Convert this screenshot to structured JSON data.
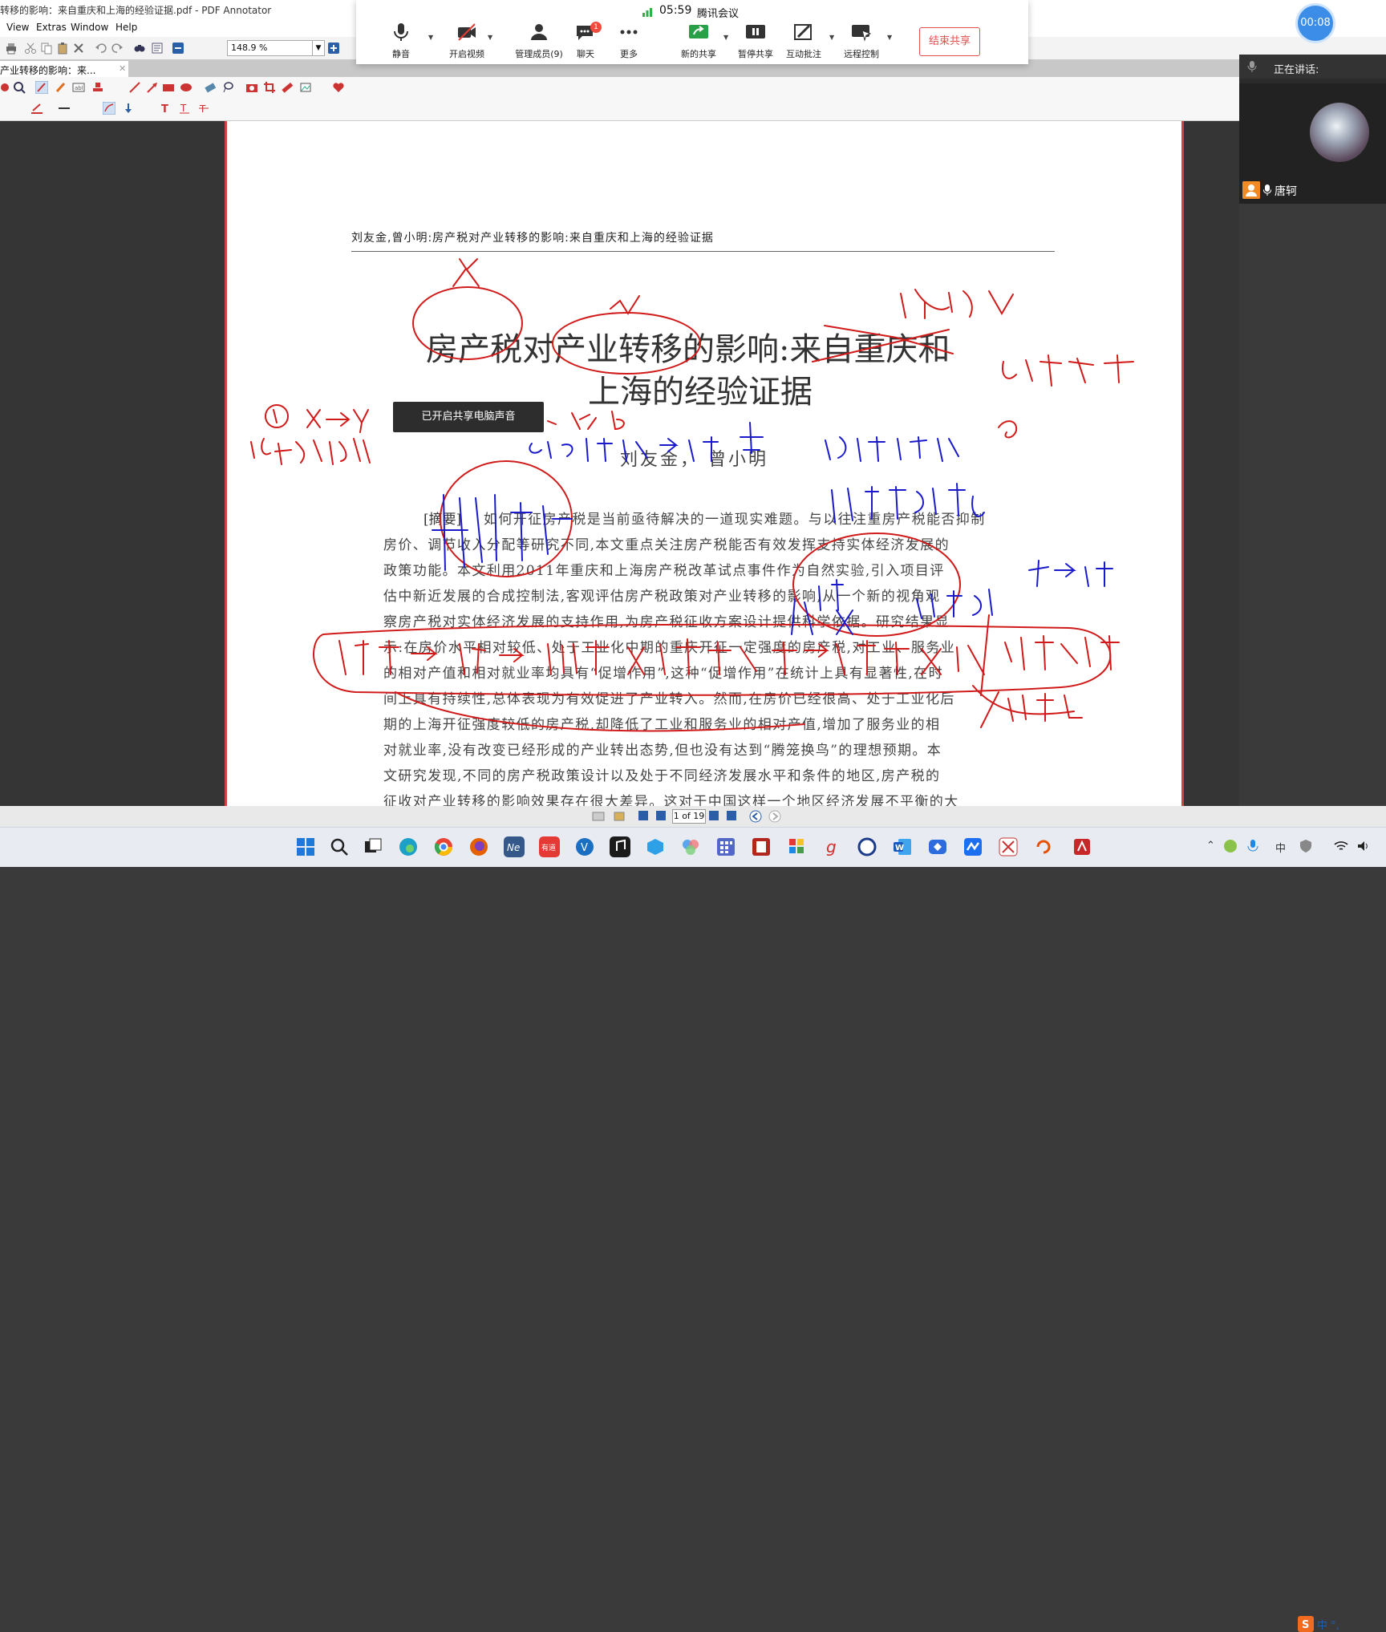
{
  "window": {
    "title": "转移的影响：来自重庆和上海的经验证据.pdf - PDF Annotator"
  },
  "menu": {
    "items": [
      "View",
      "Extras",
      "Window",
      "Help"
    ]
  },
  "toolbar": {
    "zoom_value": "148.9 %"
  },
  "tab": {
    "label": "产业转移的影响：来...",
    "close": "✕"
  },
  "document": {
    "running_head": "刘友金,曾小明:房产税对产业转移的影响:来自重庆和上海的经验证据",
    "title_line1": "房产税对产业转移的影响:来自重庆和",
    "title_line2": "上海的经验证据",
    "authors": "刘友金，  曾小明",
    "abstract_label": "[摘要]",
    "abstract_lines": [
      "如何开征房产税是当前亟待解决的一道现实难题。与以往注重房产税能否抑制",
      "房价、调节收入分配等研究不同,本文重点关注房产税能否有效发挥支持实体经济发展的",
      "政策功能。本文利用2011年重庆和上海房产税改革试点事件作为自然实验,引入项目评",
      "估中新近发展的合成控制法,客观评估房产税政策对产业转移的影响,从一个新的视角观",
      "察房产税对实体经济发展的支持作用,为房产税征收方案设计提供科学依据。研究结果显",
      "示:在房价水平相对较低、处于工业化中期的重庆开征一定强度的房产税,对工业、服务业",
      "的相对产值和相对就业率均具有“促增作用”,这种“促增作用”在统计上具有显著性,在时",
      "间上具有持续性,总体表现为有效促进了产业转入。然而,在房价已经很高、处于工业化后",
      "期的上海开征强度较低的房产税,却降低了工业和服务业的相对产值,增加了服务业的相",
      "对就业率,没有改变已经形成的产业转出态势,但也没有达到“腾笼换鸟”的理想预期。本",
      "文研究发现,不同的房产税政策设计以及处于不同经济发展水平和条件的地区,房产税的",
      "征收对产业转移的影响效果存在很大差异。这对于中国这样一个地区经济发展不平衡的大"
    ]
  },
  "toast": {
    "text": "已开启共享电脑声音"
  },
  "page_nav": {
    "page_label": "1 of 19"
  },
  "meeting": {
    "time": "05:59",
    "app_name": "腾讯会议",
    "buttons": [
      {
        "label": "静音",
        "icon": "microphone-icon"
      },
      {
        "label": "开启视频",
        "icon": "camera-off-icon"
      },
      {
        "label": "管理成员(9)",
        "icon": "members-icon"
      },
      {
        "label": "聊天",
        "icon": "chat-icon",
        "badge": "1"
      },
      {
        "label": "更多",
        "icon": "more-icon"
      },
      {
        "label": "新的共享",
        "icon": "share-icon"
      },
      {
        "label": "暂停共享",
        "icon": "pause-icon"
      },
      {
        "label": "互动批注",
        "icon": "annotate-icon"
      },
      {
        "label": "远程控制",
        "icon": "remote-control-icon"
      }
    ],
    "end_share": "结束共享",
    "timer": "00:08",
    "speaking_label": "正在讲话:",
    "speaker_name": "唐轲"
  },
  "taskbar": {
    "ime_text": "中 °,",
    "tray_lang": "中"
  },
  "colors": {
    "accent_meeting": "#3b8de8",
    "end_share": "#e25050",
    "ink_red": "#d11a1a",
    "ink_blue": "#1a1acc"
  }
}
